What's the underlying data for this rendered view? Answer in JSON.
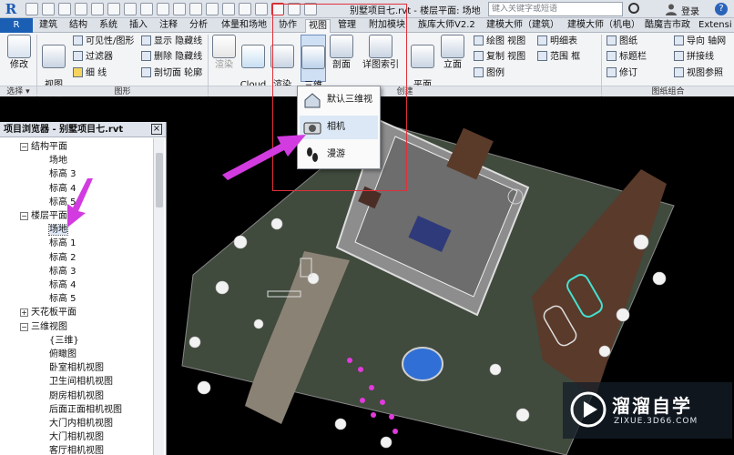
{
  "titlebar": {
    "doc_title": "别墅项目七.rvt - 楼层平面: 场地",
    "search_placeholder": "键入关键字或短语",
    "login": "登录",
    "help": "?"
  },
  "tabs": {
    "file": "R",
    "items": [
      "建筑",
      "结构",
      "系统",
      "插入",
      "注释",
      "分析",
      "体量和场地",
      "协作",
      "视图",
      "管理",
      "附加模块",
      "族库大师V2.2",
      "建模大师（建筑）",
      "建模大师（机电）",
      "酷魔吉市政",
      "Extensi"
    ],
    "active_index": 8
  },
  "ribbon": {
    "modify": "修改",
    "view_template": "视图\n样板",
    "visibility_graphics": "可见性/图形",
    "filters": "过滤器",
    "thin_lines": "细 线",
    "show_hidden": "显示 隐藏线",
    "remove_hidden": "删除 隐藏线",
    "cut_profile": "剖切面 轮廓",
    "render": "渲染",
    "cloud_render": "Cloud\n渲染",
    "render_gallery": "渲染\n库",
    "three_d_view": "三维\n视图",
    "section": "剖面",
    "callout": "详图索引",
    "plan_views": "平面\n视图",
    "elevation": "立面",
    "drafting_view": "绘图 视图",
    "duplicate_view": "复制 视图",
    "legends": "图例",
    "schedules": "明细表",
    "scope_box": "范围 框",
    "sheet": "图纸",
    "title_block": "标题栏",
    "revisions": "修订",
    "guide_grid": "导向 轴网",
    "matchline": "拼接线",
    "view_ref": "视图参照",
    "group_select": "选择 ▾",
    "group_graphics": "图形",
    "group_create": "创建",
    "group_sheet": "图纸组合"
  },
  "dropdown": {
    "items": [
      "默认三维视图",
      "相机",
      "漫游"
    ]
  },
  "browser": {
    "title": "项目浏览器 - 别墅项目七.rvt",
    "tree": [
      {
        "label": "结构平面",
        "level": 1,
        "toggle": "−"
      },
      {
        "label": "场地",
        "level": 2
      },
      {
        "label": "标高 3",
        "level": 2
      },
      {
        "label": "标高 4",
        "level": 2
      },
      {
        "label": "标高 5",
        "level": 2
      },
      {
        "label": "楼层平面",
        "level": 1,
        "toggle": "−"
      },
      {
        "label": "场地",
        "level": 2,
        "selected": true
      },
      {
        "label": "标高 1",
        "level": 2
      },
      {
        "label": "标高 2",
        "level": 2
      },
      {
        "label": "标高 3",
        "level": 2
      },
      {
        "label": "标高 4",
        "level": 2
      },
      {
        "label": "标高 5",
        "level": 2
      },
      {
        "label": "天花板平面",
        "level": 1,
        "toggle": "+"
      },
      {
        "label": "三维视图",
        "level": 1,
        "toggle": "−"
      },
      {
        "label": "{三维}",
        "level": 2
      },
      {
        "label": "俯瞰图",
        "level": 2
      },
      {
        "label": "卧室相机视图",
        "level": 2
      },
      {
        "label": "卫生间相机视图",
        "level": 2
      },
      {
        "label": "厨房相机视图",
        "level": 2
      },
      {
        "label": "后面正面相机视图",
        "level": 2
      },
      {
        "label": "大门内相机视图",
        "level": 2
      },
      {
        "label": "大门相机视图",
        "level": 2
      },
      {
        "label": "客厅相机视图",
        "level": 2
      }
    ]
  },
  "watermark": {
    "title": "溜溜自学",
    "sub": "ZIXUE.3D66.COM"
  },
  "colors": {
    "accent": "#1a5fb4",
    "arrow": "#d23be0",
    "highlight_box": "#e0303a",
    "grass": "#3f4a3c",
    "drive": "#5a3a2a"
  }
}
